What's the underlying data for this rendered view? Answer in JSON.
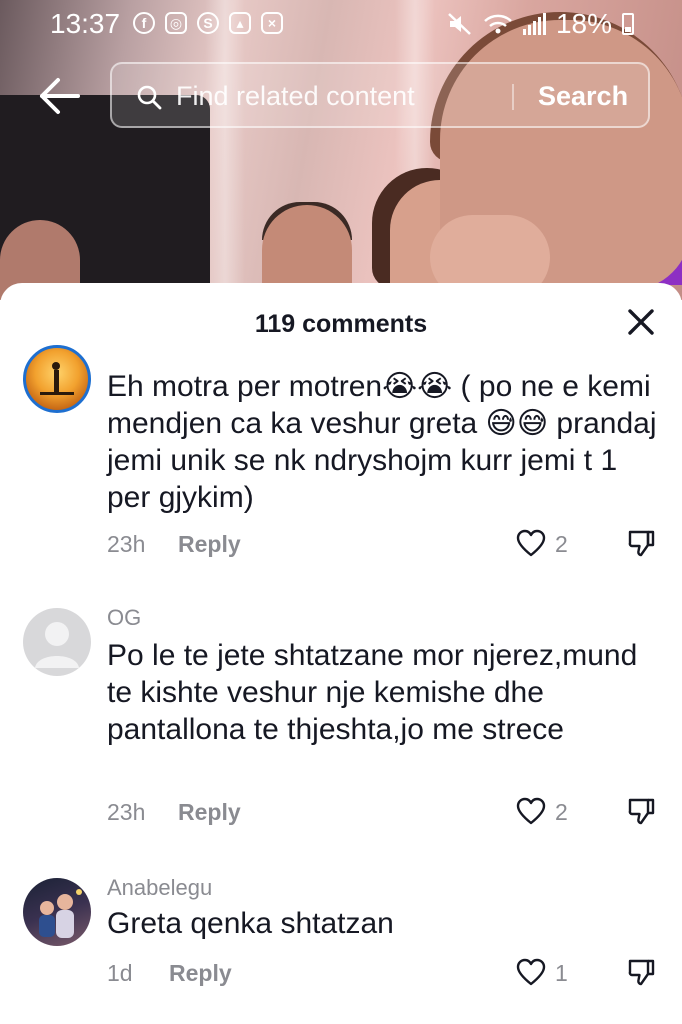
{
  "status_bar": {
    "time": "13:37",
    "battery": "18%",
    "notification_icons": [
      "facebook-icon",
      "instagram-icon",
      "shazam-icon",
      "gallery-icon",
      "close-box-icon"
    ],
    "system_icons": [
      "mute-icon",
      "wifi-icon",
      "signal-icon",
      "battery-icon"
    ]
  },
  "search": {
    "placeholder": "Find related content",
    "button_label": "Search"
  },
  "comments_panel": {
    "title": "119 comments",
    "comments": [
      {
        "username": "",
        "text": "Eh motra per motren😭😭 ( po ne e kemi mendjen ca ka veshur greta 😅😅 prandaj jemi unik se nk ndryshojm kurr jemi t 1 per gjykim)",
        "time": "23h",
        "reply_label": "Reply",
        "likes": "2"
      },
      {
        "username": "OG",
        "text": "Po le te jete shtatzane mor njerez,mund te kishte veshur nje kemishe dhe pantallona te thjeshta,jo me strece",
        "time": "23h",
        "reply_label": "Reply",
        "likes": "2"
      },
      {
        "username": "Anabelegu",
        "text": "Greta qenka shtatzan",
        "time": "1d",
        "reply_label": "Reply",
        "likes": "1"
      }
    ]
  },
  "colors": {
    "primary_text": "#161823",
    "secondary_text": "#8a8b91",
    "sheet_background": "#ffffff",
    "avatar_placeholder": "#d8d8da"
  }
}
